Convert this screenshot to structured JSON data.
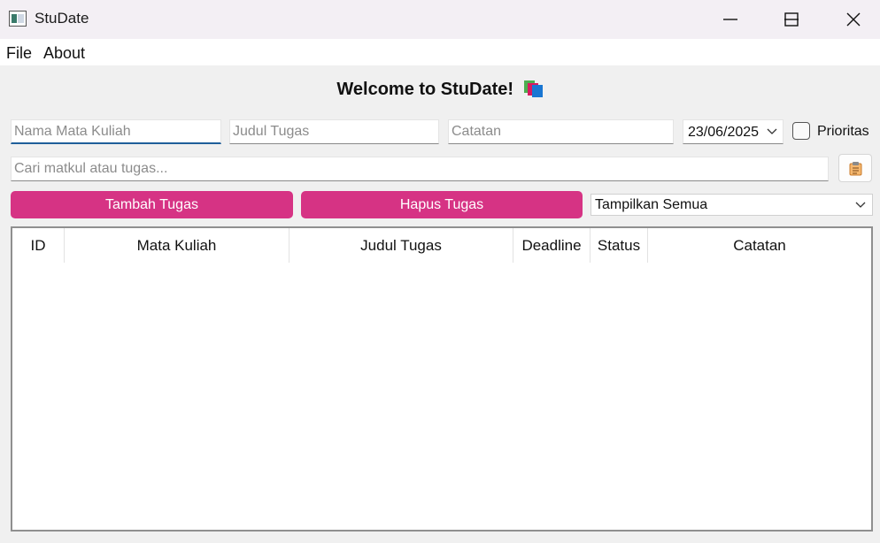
{
  "window": {
    "title": "StuDate",
    "controls": [
      "minimize-icon",
      "maximize-icon",
      "close-icon"
    ]
  },
  "menu": {
    "file": "File",
    "about": "About"
  },
  "heading": {
    "text": "Welcome to StuDate!",
    "icon": "books-icon"
  },
  "form": {
    "course_placeholder": "Nama Mata Kuliah",
    "task_placeholder": "Judul Tugas",
    "note_placeholder": "Catatan",
    "date_value": "23/06/2025",
    "priority_label": "Prioritas",
    "priority_checked": false
  },
  "search": {
    "placeholder": "Cari matkul atau tugas...",
    "tool_icon": "clipboard-icon"
  },
  "actions": {
    "add_label": "Tambah Tugas",
    "delete_label": "Hapus Tugas",
    "filter_value": "Tampilkan Semua"
  },
  "table": {
    "columns": [
      "ID",
      "Mata Kuliah",
      "Judul Tugas",
      "Deadline",
      "Status",
      "Catatan"
    ],
    "rows": []
  },
  "colors": {
    "accent": "#d63384",
    "focus": "#1f5f9a",
    "titlebar": "#f3eff4",
    "window_bg": "#f0f0f0"
  }
}
